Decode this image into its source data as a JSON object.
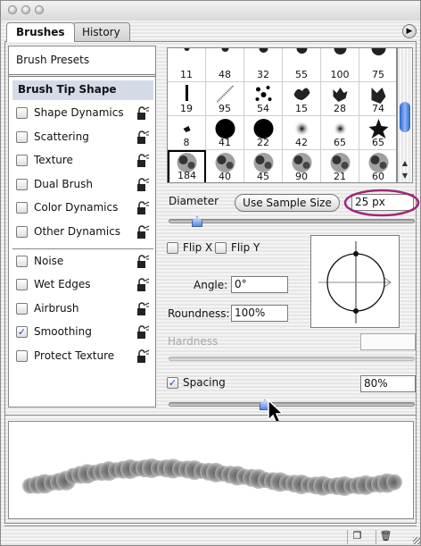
{
  "tabs": [
    {
      "label": "Brushes",
      "active": true
    },
    {
      "label": "History",
      "active": false
    }
  ],
  "left_panel": {
    "presets_label": "Brush Presets",
    "tip_shape_label": "Brush Tip Shape",
    "options": [
      {
        "label": "Shape Dynamics",
        "checked": false,
        "lock": true
      },
      {
        "label": "Scattering",
        "checked": false,
        "lock": true
      },
      {
        "label": "Texture",
        "checked": false,
        "lock": true
      },
      {
        "label": "Dual Brush",
        "checked": false,
        "lock": true
      },
      {
        "label": "Color Dynamics",
        "checked": false,
        "lock": true
      },
      {
        "label": "Other Dynamics",
        "checked": false,
        "lock": true
      },
      {
        "label": "Noise",
        "checked": false,
        "lock": true
      },
      {
        "label": "Wet Edges",
        "checked": false,
        "lock": true
      },
      {
        "label": "Airbrush",
        "checked": false,
        "lock": true
      },
      {
        "label": "Smoothing",
        "checked": true,
        "lock": true
      },
      {
        "label": "Protect Texture",
        "checked": false,
        "lock": true
      }
    ]
  },
  "brush_grid": {
    "rows": [
      [
        "11",
        "48",
        "32",
        "55",
        "100",
        "75"
      ],
      [
        "19",
        "95",
        "54",
        "15",
        "28",
        "74"
      ],
      [
        "8",
        "41",
        "22",
        "42",
        "65",
        "65"
      ],
      [
        "184",
        "40",
        "45",
        "90",
        "21",
        "60"
      ]
    ],
    "selected": "184"
  },
  "diameter": {
    "label": "Diameter",
    "sample_button": "Use Sample Size",
    "value": "25 px",
    "highlight_color": "#a0267a"
  },
  "flip": {
    "x_label": "Flip X",
    "y_label": "Flip Y"
  },
  "angle": {
    "label": "Angle:",
    "value": "0°"
  },
  "roundness": {
    "label": "Roundness:",
    "value": "100%"
  },
  "hardness": {
    "label": "Hardness",
    "value": ""
  },
  "spacing": {
    "label": "Spacing",
    "checked": true,
    "value": "80%"
  },
  "colors": {
    "accent": "#2b63d3",
    "selection_bg": "#d5dbe6"
  }
}
